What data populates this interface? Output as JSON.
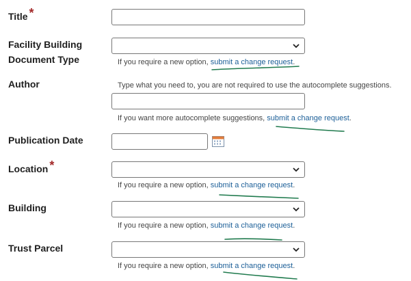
{
  "form": {
    "title": {
      "label": "Title",
      "required_mark": "*"
    },
    "doc_type": {
      "label_line1": "Facility Building",
      "label_line2": "Document Type",
      "help_prefix": "If you require a new option, ",
      "help_link": "submit a change request",
      "help_suffix": "."
    },
    "author": {
      "label": "Author",
      "instruction": "Type what you need to, you are not required to use the autocomplete suggestions.",
      "help_prefix": "If you want more autocomplete suggestions, ",
      "help_link": "submit a change request",
      "help_suffix": "."
    },
    "publication_date": {
      "label": "Publication Date",
      "calendar_icon": "calendar-icon"
    },
    "location": {
      "label": "Location",
      "required_mark": "*",
      "help_prefix": "If you require a new option, ",
      "help_link": "submit a change request",
      "help_suffix": "."
    },
    "building": {
      "label": "Building",
      "help_prefix": "If you require a new option, ",
      "help_link": "submit a change request",
      "help_suffix": "."
    },
    "trust_parcel": {
      "label": "Trust Parcel",
      "help_prefix": "If you require a new option, ",
      "help_link": "submit a change request",
      "help_suffix": "."
    }
  },
  "colors": {
    "link": "#1b5e97",
    "required": "#a32a2a",
    "annotation": "#1f7a4d"
  }
}
